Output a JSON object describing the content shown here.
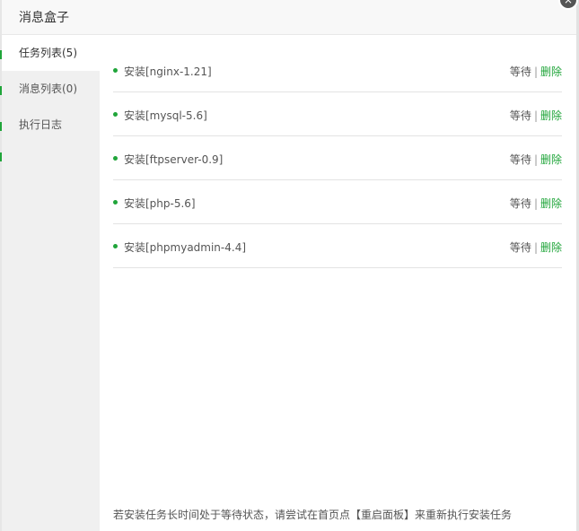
{
  "header": {
    "title": "消息盒子",
    "close_icon": "×"
  },
  "sidebar": {
    "items": [
      {
        "label": "任务列表(5)",
        "active": true
      },
      {
        "label": "消息列表(0)",
        "active": false
      },
      {
        "label": "执行日志",
        "active": false
      }
    ]
  },
  "tasks": [
    {
      "name": "安装[nginx-1.21]",
      "status": "等待",
      "delete": "删除"
    },
    {
      "name": "安装[mysql-5.6]",
      "status": "等待",
      "delete": "删除"
    },
    {
      "name": "安装[ftpserver-0.9]",
      "status": "等待",
      "delete": "删除"
    },
    {
      "name": "安装[php-5.6]",
      "status": "等待",
      "delete": "删除"
    },
    {
      "name": "安装[phpmyadmin-4.4]",
      "status": "等待",
      "delete": "删除"
    }
  ],
  "separator": "|",
  "footer": {
    "note": "若安装任务长时间处于等待状态，请尝试在首页点【重启面板】来重新执行安装任务"
  },
  "colors": {
    "accent": "#20a53a",
    "sidebar_bg": "#f0f0f0",
    "header_bg": "#f8f8f8"
  }
}
